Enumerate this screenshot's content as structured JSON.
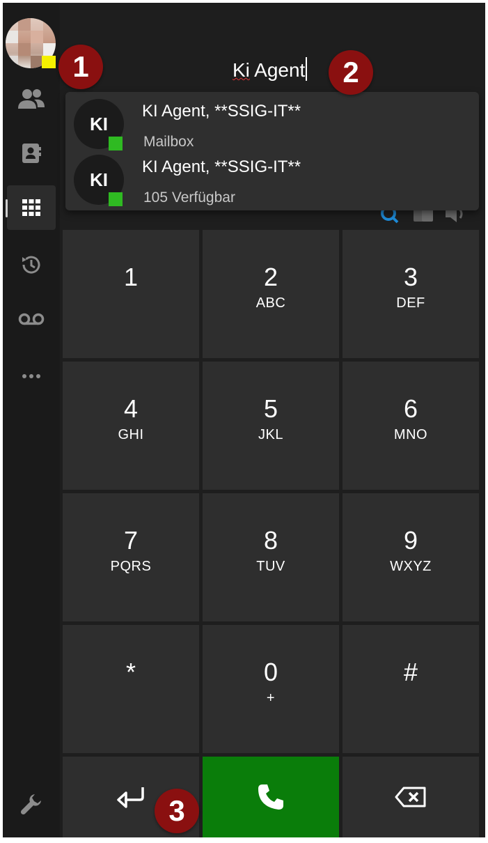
{
  "search": {
    "query_word1": "Ki",
    "query_word2": " Agent"
  },
  "results": [
    {
      "initials": "KI",
      "name": "KI Agent, **SSIG-IT**",
      "detail": "Mailbox",
      "status_color": "#2fba22"
    },
    {
      "initials": "KI",
      "name": "KI Agent, **SSIG-IT**",
      "detail": "105 Verfügbar",
      "status_color": "#2fba22"
    }
  ],
  "user_status_color": "#f5f000",
  "sidebar": {
    "items": [
      {
        "icon": "people-icon"
      },
      {
        "icon": "contact-card-icon"
      },
      {
        "icon": "dialpad-icon",
        "active": true
      },
      {
        "icon": "history-icon"
      },
      {
        "icon": "voicemail-icon"
      },
      {
        "icon": "more-icon"
      }
    ],
    "bottom_icon": "wrench-icon"
  },
  "keypad": [
    {
      "digit": "1",
      "letters": ""
    },
    {
      "digit": "2",
      "letters": "ABC"
    },
    {
      "digit": "3",
      "letters": "DEF"
    },
    {
      "digit": "4",
      "letters": "GHI"
    },
    {
      "digit": "5",
      "letters": "JKL"
    },
    {
      "digit": "6",
      "letters": "MNO"
    },
    {
      "digit": "7",
      "letters": "PQRS"
    },
    {
      "digit": "8",
      "letters": "TUV"
    },
    {
      "digit": "9",
      "letters": "WXYZ"
    },
    {
      "digit": "*",
      "letters": ""
    },
    {
      "digit": "0",
      "letters": "+"
    },
    {
      "digit": "#",
      "letters": ""
    }
  ],
  "actions": {
    "enter_icon": "return-arrow-icon",
    "call_icon": "phone-icon",
    "call_color": "#0a7d0a",
    "backspace_icon": "backspace-icon"
  },
  "markers": [
    "1",
    "2",
    "3"
  ]
}
